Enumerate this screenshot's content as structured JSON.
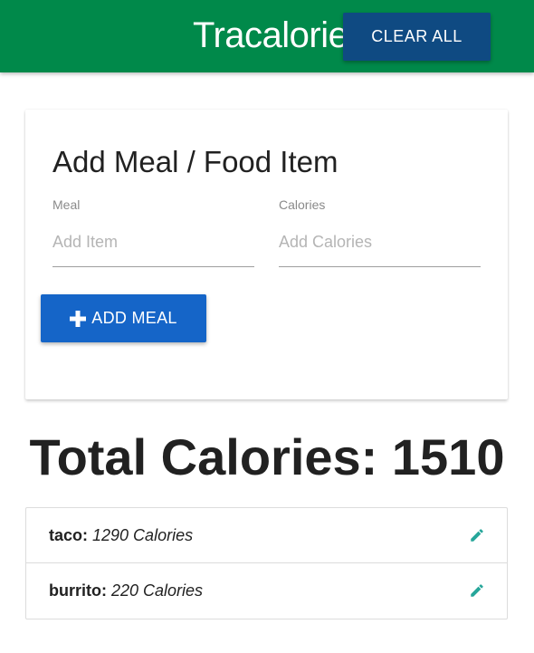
{
  "header": {
    "brand": "Tracalorie",
    "clear_label": "CLEAR ALL"
  },
  "form": {
    "title": "Add Meal / Food Item",
    "meal_label": "Meal",
    "meal_placeholder": "Add Item",
    "meal_value": "",
    "calories_label": "Calories",
    "calories_placeholder": "Add Calories",
    "calories_value": "",
    "add_label": "ADD MEAL",
    "add_icon": "plus-icon"
  },
  "total": {
    "label": "Total Calories: 1510"
  },
  "items": [
    {
      "name": "taco:",
      "calories": "1290 Calories",
      "icon": "pencil-icon"
    },
    {
      "name": "burrito:",
      "calories": "220 Calories",
      "icon": "pencil-icon"
    }
  ],
  "colors": {
    "navbar": "#00894a",
    "clear_button": "#0f4a82",
    "add_button": "#1565c8",
    "edit_icon": "#26a69a"
  }
}
